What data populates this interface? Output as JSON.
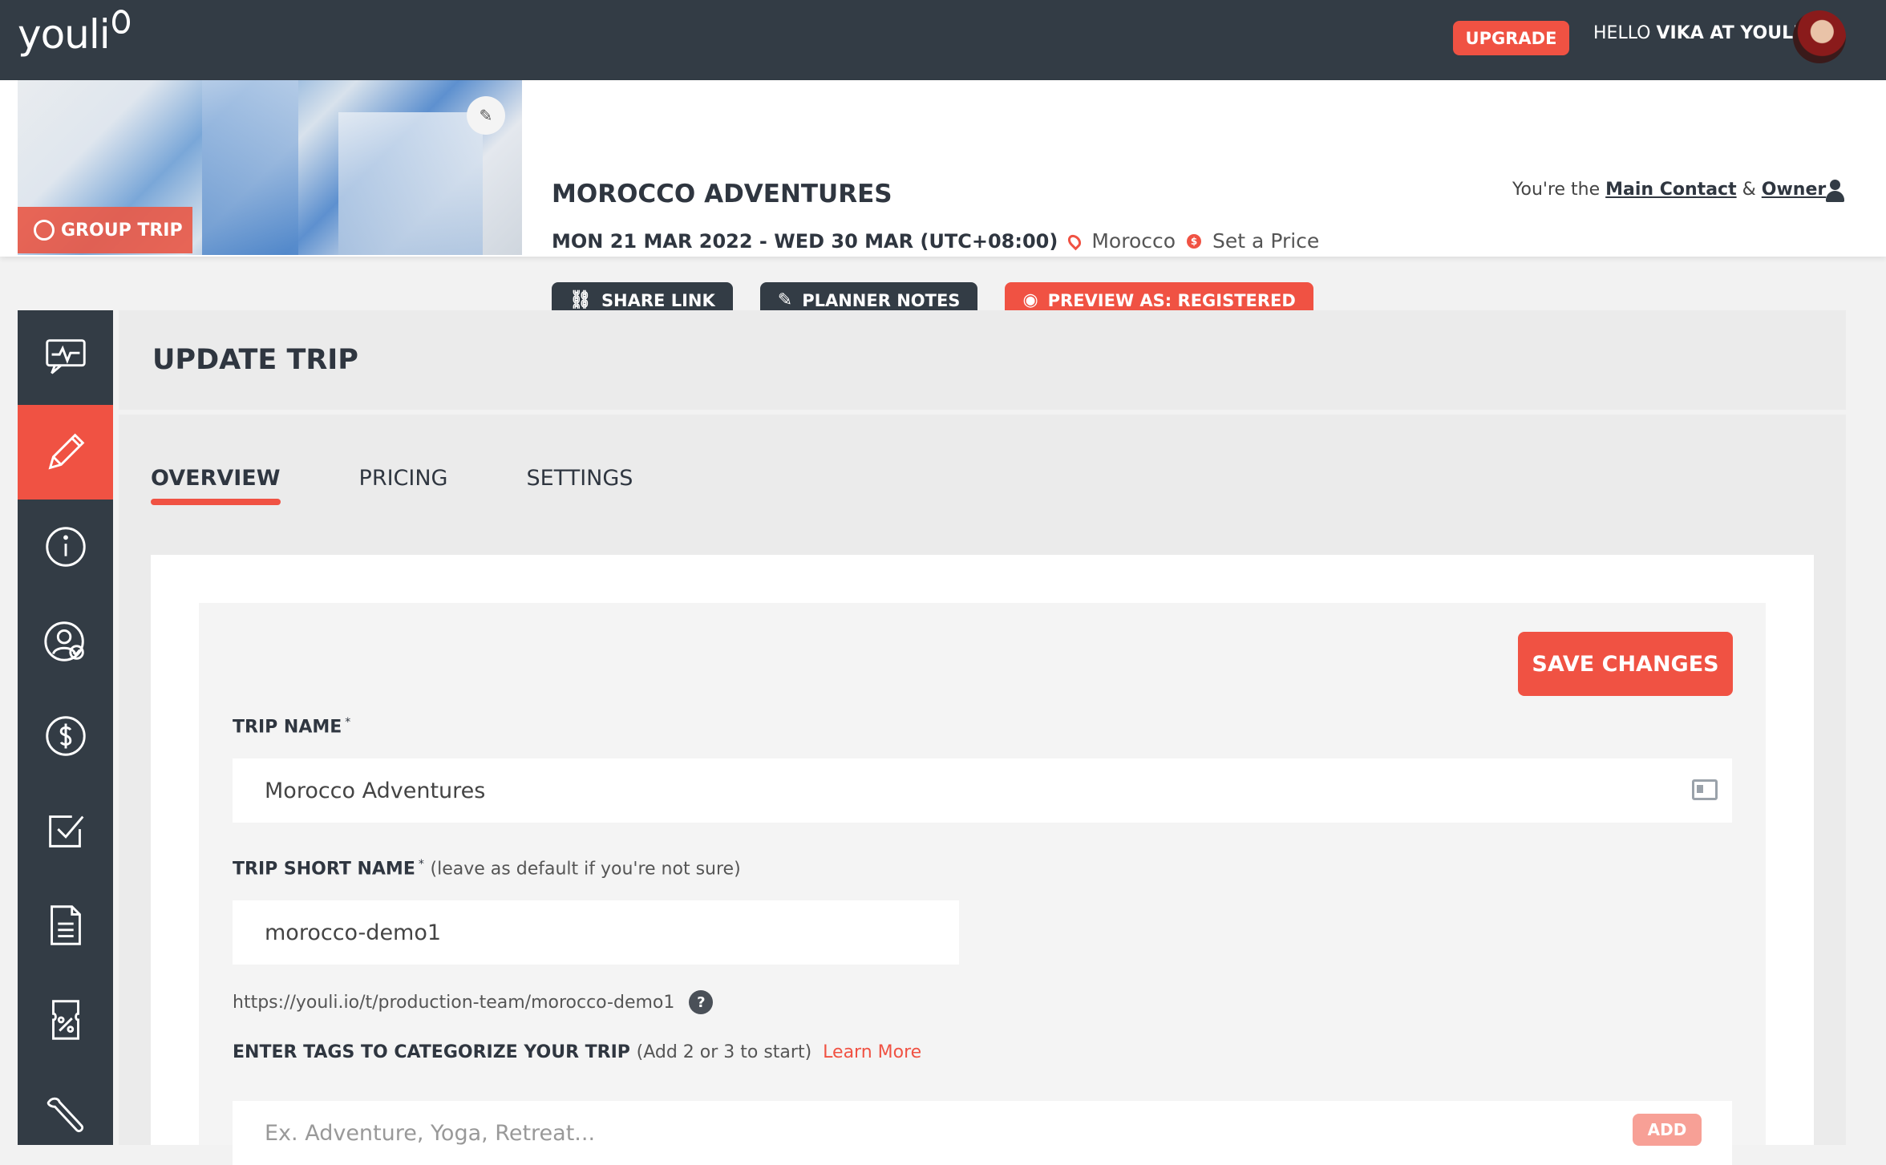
{
  "app": {
    "logo_text": "youli",
    "upgrade_label": "UPGRADE",
    "hello_prefix": "HELLO ",
    "hello_user": "VIKA AT YOULI"
  },
  "trip": {
    "badge_label": "GROUP TRIP",
    "title": "MOROCCO ADVENTURES",
    "dates": "MON 21 MAR 2022 - WED 30 MAR (UTC+08:00)",
    "location": "Morocco",
    "price_label": "Set a Price",
    "price_icon": "$",
    "actions": {
      "share_link": "SHARE LINK",
      "planner_notes": "PLANNER NOTES",
      "preview_as": "PREVIEW AS: REGISTERED"
    },
    "contact": {
      "prefix": "You're the ",
      "main_contact": "Main Contact",
      "amp": " & ",
      "owner": "Owner"
    }
  },
  "sidebar": {
    "items": [
      {
        "icon": "activity-chat-icon"
      },
      {
        "icon": "pencil-icon",
        "active": true
      },
      {
        "icon": "info-icon"
      },
      {
        "icon": "user-check-icon"
      },
      {
        "icon": "dollar-icon"
      },
      {
        "icon": "checkbox-icon"
      },
      {
        "icon": "document-icon"
      },
      {
        "icon": "coupon-icon"
      },
      {
        "icon": "wrench-icon"
      }
    ]
  },
  "main": {
    "heading": "UPDATE TRIP",
    "tabs": [
      {
        "label": "OVERVIEW",
        "active": true
      },
      {
        "label": "PRICING"
      },
      {
        "label": "SETTINGS"
      }
    ],
    "save_label": "SAVE CHANGES",
    "form": {
      "trip_name_label": "TRIP NAME",
      "required_mark": "*",
      "trip_name_value": "Morocco Adventures",
      "short_name_label": "TRIP SHORT NAME",
      "short_name_hint": "(leave as default if you're not sure)",
      "short_name_value": "morocco-demo1",
      "url": "https://youli.io/t/production-team/morocco-demo1",
      "help_mark": "?",
      "tags_label": "ENTER TAGS TO CATEGORIZE YOUR TRIP",
      "tags_hint": "(Add 2 or 3 to start)",
      "learn_more": "Learn More",
      "tags_placeholder": "Ex. Adventure, Yoga, Retreat...",
      "add_label": "ADD"
    }
  },
  "colors": {
    "accent": "#f05243",
    "dark": "#333c45"
  }
}
